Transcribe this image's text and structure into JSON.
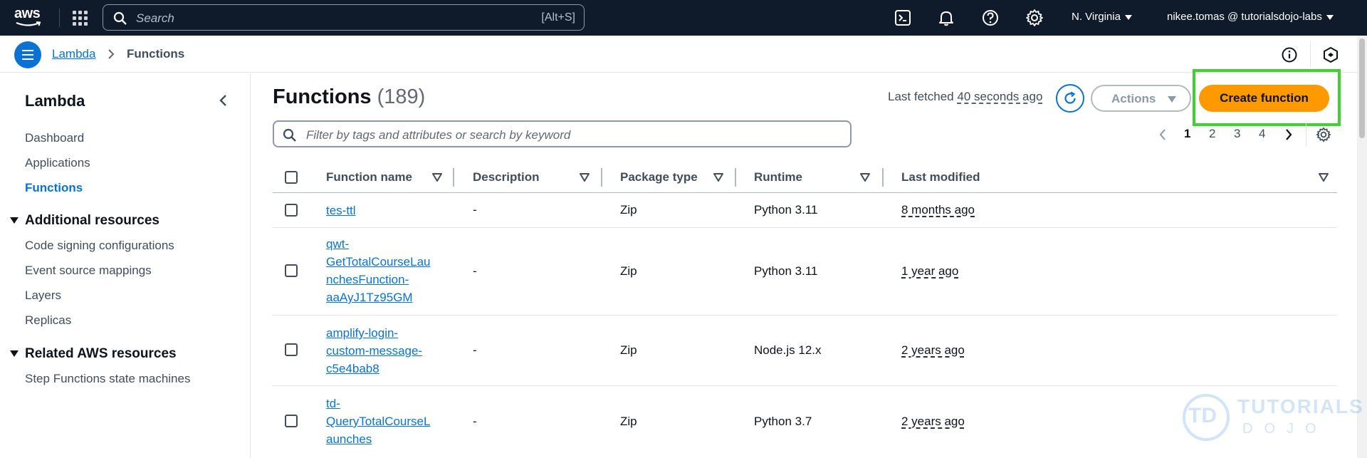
{
  "topbar": {
    "logo": "aws",
    "search_placeholder": "Search",
    "search_shortcut": "[Alt+S]",
    "region": "N. Virginia",
    "account": "nikee.tomas @ tutorialsdojo-labs",
    "icons": [
      "apps-grid-icon",
      "cloudshell-icon",
      "bell-icon",
      "help-icon",
      "gear-icon"
    ]
  },
  "breadcrumb": {
    "parent": "Lambda",
    "current": "Functions"
  },
  "sidebar": {
    "title": "Lambda",
    "items": [
      "Dashboard",
      "Applications",
      "Functions"
    ],
    "active_item": "Functions",
    "sections": [
      {
        "title": "Additional resources",
        "items": [
          "Code signing configurations",
          "Event source mappings",
          "Layers",
          "Replicas"
        ]
      },
      {
        "title": "Related AWS resources",
        "items": [
          "Step Functions state machines"
        ]
      }
    ]
  },
  "main": {
    "title": "Functions",
    "count": "(189)",
    "last_fetched_label": "Last fetched",
    "last_fetched_time": "40 seconds ago",
    "actions_label": "Actions",
    "create_label": "Create function",
    "filter_placeholder": "Filter by tags and attributes or search by keyword",
    "pages": [
      "1",
      "2",
      "3",
      "4"
    ],
    "current_page": "1"
  },
  "table": {
    "columns": [
      "Function name",
      "Description",
      "Package type",
      "Runtime",
      "Last modified"
    ],
    "rows": [
      {
        "name": "tes-ttl",
        "description": "-",
        "package": "Zip",
        "runtime": "Python 3.11",
        "modified": "8 months ago"
      },
      {
        "name": "qwt-GetTotalCourseLaunchesFunction-aaAyJ1Tz95GM",
        "name_lines": [
          "qwt-",
          "GetTotalCourseLau",
          "nchesFunction-",
          "aaAyJ1Tz95GM"
        ],
        "description": "-",
        "package": "Zip",
        "runtime": "Python 3.11",
        "modified": "1 year ago"
      },
      {
        "name": "amplify-login-custom-message-c5e4bab8",
        "name_lines": [
          "amplify-login-",
          "custom-message-",
          "c5e4bab8"
        ],
        "description": "-",
        "package": "Zip",
        "runtime": "Node.js 12.x",
        "modified": "2 years ago"
      },
      {
        "name": "td-QueryTotalCourseLaunches",
        "name_lines": [
          "td-",
          "QueryTotalCourseL",
          "aunches"
        ],
        "description": "-",
        "package": "Zip",
        "runtime": "Python 3.7",
        "modified": "2 years ago"
      }
    ]
  },
  "watermark": {
    "mark": "TD",
    "line1": "TUTORIALS",
    "line2": "DOJO"
  },
  "colors": {
    "topbar_bg": "#0f1b2a",
    "link": "#0972d3",
    "primary_button": "#ff9900",
    "highlight_box": "#3fd12f"
  }
}
